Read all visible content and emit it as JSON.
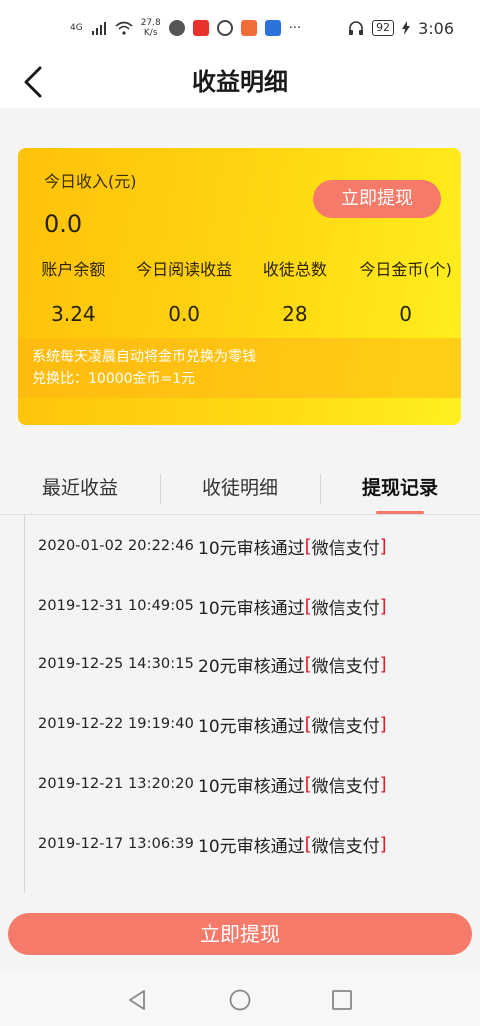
{
  "status_bar": {
    "network": "4G",
    "speed": "27.8",
    "speed_unit": "K/s",
    "battery": "92",
    "time": "3:06",
    "more": "···"
  },
  "header": {
    "title": "收益明细"
  },
  "summary": {
    "today_income_label": "今日收入(元)",
    "today_income_value": "0.0",
    "withdraw_label": "立即提现",
    "stats": [
      {
        "label": "账户余额",
        "value": "3.24"
      },
      {
        "label": "今日阅读收益",
        "value": "0.0"
      },
      {
        "label": "收徒总数",
        "value": "28"
      },
      {
        "label": "今日金币(个)",
        "value": "0"
      }
    ],
    "notice_line1": "系统每天凌晨自动将金币兑换为零钱",
    "notice_line2": "兑换比：10000金币=1元"
  },
  "tabs": [
    {
      "label": "最近收益",
      "active": false
    },
    {
      "label": "收徒明细",
      "active": false
    },
    {
      "label": "提现记录",
      "active": true
    }
  ],
  "records": [
    {
      "time": "2020-01-02 20:22:46",
      "desc": "10元审核通过",
      "open": "[",
      "method": "微信支付",
      "close": "]"
    },
    {
      "time": "2019-12-31 10:49:05",
      "desc": "10元审核通过",
      "open": "[",
      "method": "微信支付",
      "close": "]"
    },
    {
      "time": "2019-12-25 14:30:15",
      "desc": "20元审核通过",
      "open": "[",
      "method": "微信支付",
      "close": "]"
    },
    {
      "time": "2019-12-22 19:19:40",
      "desc": "10元审核通过",
      "open": "[",
      "method": "微信支付",
      "close": "]"
    },
    {
      "time": "2019-12-21 13:20:20",
      "desc": "10元审核通过",
      "open": "[",
      "method": "微信支付",
      "close": "]"
    },
    {
      "time": "2019-12-17 13:06:39",
      "desc": "10元审核通过",
      "open": "[",
      "method": "微信支付",
      "close": "]"
    }
  ],
  "bottom_button": {
    "label": "立即提现"
  },
  "colors": {
    "accent": "#f57a6a",
    "card_start": "#ffc20a",
    "card_end": "#fff01e",
    "bracket_red": "#e0192b"
  },
  "icons": {
    "back": "chevron-left-icon",
    "nav_back": "triangle-back-icon",
    "nav_home": "circle-home-icon",
    "nav_recent": "square-recent-icon"
  }
}
